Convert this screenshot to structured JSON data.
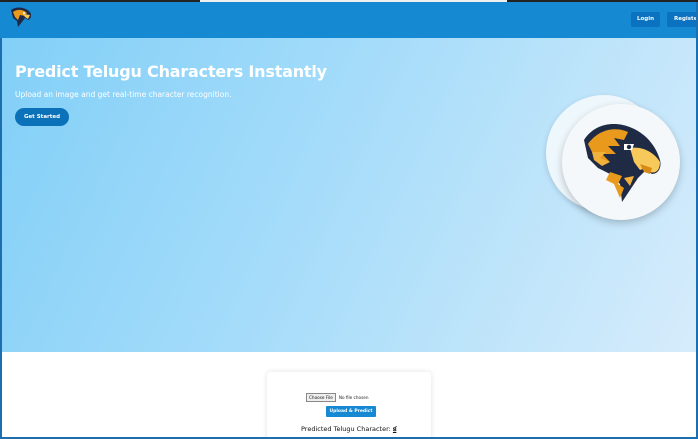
{
  "nav": {
    "login_label": "Login",
    "register_label": "Register",
    "logo_icon": "eagle-logo-icon"
  },
  "hero": {
    "title": "Predict Telugu Characters Instantly",
    "subtitle": "Upload an image and get real-time character recognition.",
    "cta_label": "Get Started",
    "image_icon": "eagle-mascot-icon"
  },
  "upload": {
    "file_button_label": "Choose File",
    "file_status": "No file chosen",
    "submit_label": "Upload & Predict",
    "result_label": "Predicted Telugu Character:",
    "result_value": "క"
  },
  "colors": {
    "navbar": "#1689d3",
    "button": "#0b71b9",
    "hero_start": "#82cff7",
    "hero_end": "#d6ecfb",
    "eagle_orange": "#e99a1c"
  }
}
